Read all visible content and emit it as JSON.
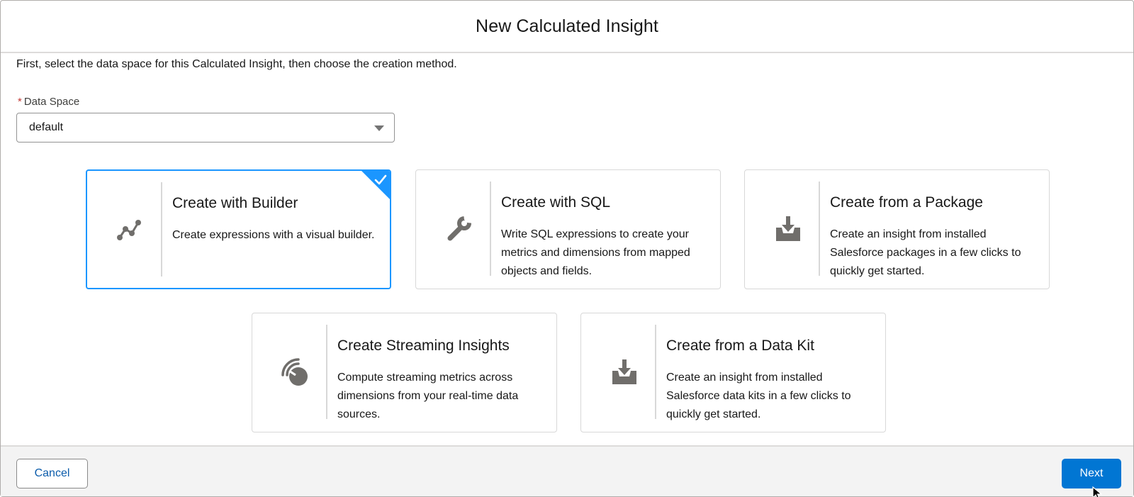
{
  "modal": {
    "title": "New Calculated Insight",
    "intro": "First, select the data space for this Calculated Insight, then choose the creation method."
  },
  "data_space": {
    "required_marker": "*",
    "label": "Data Space",
    "value": "default"
  },
  "tiles": [
    {
      "title": "Create with Builder",
      "description": "Create expressions with a visual builder.",
      "icon": "builder-icon",
      "selected": true
    },
    {
      "title": "Create with SQL",
      "description": "Write SQL expressions to create your metrics and dimensions from mapped objects and fields.",
      "icon": "wrench-icon",
      "selected": false
    },
    {
      "title": "Create from a Package",
      "description": "Create an insight from installed Salesforce packages in a few clicks to quickly get started.",
      "icon": "download-icon",
      "selected": false
    },
    {
      "title": "Create Streaming Insights",
      "description": "Compute streaming metrics across dimensions from your real-time data sources.",
      "icon": "streaming-icon",
      "selected": false
    },
    {
      "title": "Create from a Data Kit",
      "description": "Create an insight from installed Salesforce data kits in a few clicks to quickly get started.",
      "icon": "download-icon",
      "selected": false
    }
  ],
  "footer": {
    "cancel_label": "Cancel",
    "next_label": "Next"
  },
  "colors": {
    "brand": "#0176d3",
    "selected_border": "#1b96ff",
    "link": "#0b5cab",
    "icon": "#706e6b"
  }
}
